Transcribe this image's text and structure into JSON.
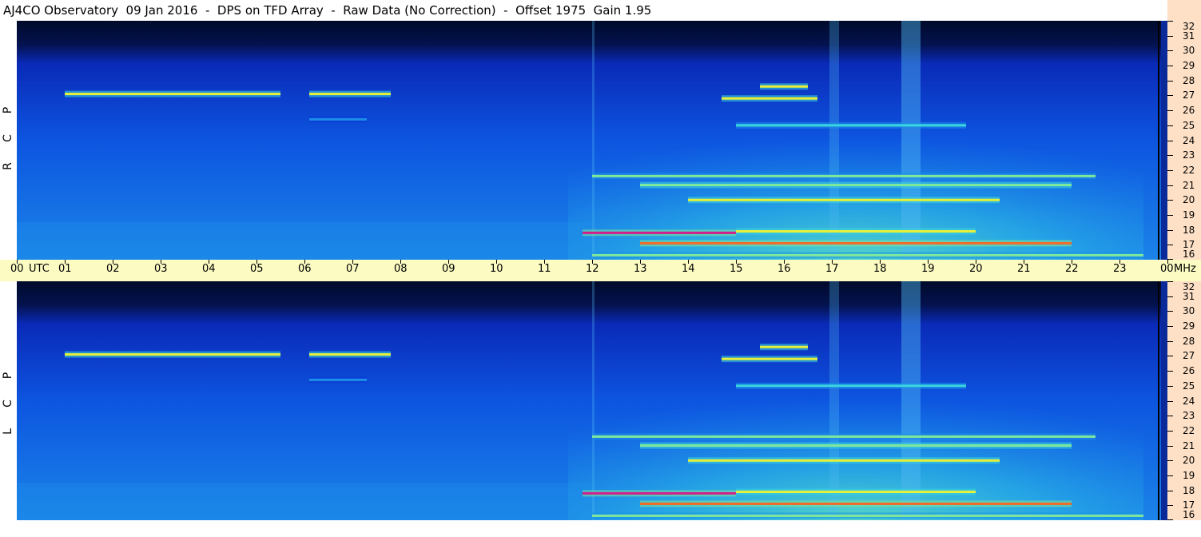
{
  "title": "AJ4CO Observatory  09 Jan 2016  -  DPS on TFD Array  -  Raw Data (No Correction)  -  Offset 1975  Gain 1.95",
  "chart_data": {
    "type": "heatmap",
    "panels": [
      {
        "name": "RCP",
        "side_letters": [
          "R",
          "C",
          "P"
        ]
      },
      {
        "name": "LCP",
        "side_letters": [
          "L",
          "C",
          "P"
        ]
      }
    ],
    "x_axis": {
      "unit_label": "UTC",
      "ticks": [
        "00",
        "01",
        "02",
        "03",
        "04",
        "05",
        "06",
        "07",
        "08",
        "09",
        "10",
        "11",
        "12",
        "13",
        "14",
        "15",
        "16",
        "17",
        "18",
        "19",
        "20",
        "21",
        "22",
        "23",
        "00"
      ],
      "range_hours": [
        0,
        24
      ]
    },
    "y_axis": {
      "unit_label": "MHz",
      "ticks": [
        "16",
        "17",
        "18",
        "19",
        "20",
        "21",
        "22",
        "23",
        "24",
        "25",
        "26",
        "27",
        "28",
        "29",
        "30",
        "31",
        "32"
      ],
      "range_mhz": [
        16,
        32
      ]
    },
    "colormap": [
      "#000a2a",
      "#0a1f8a",
      "#0a3bd6",
      "#1c8fe8",
      "#3ad6e0",
      "#7fe89a",
      "#e6f03a",
      "#f26a2a",
      "#d21e8c"
    ],
    "features": [
      {
        "kind": "band",
        "t_start": 1.0,
        "t_end": 5.5,
        "f_mhz": 27.1,
        "level": 0.75
      },
      {
        "kind": "band",
        "t_start": 6.1,
        "t_end": 7.8,
        "f_mhz": 27.1,
        "level": 0.7
      },
      {
        "kind": "band",
        "t_start": 6.1,
        "t_end": 7.3,
        "f_mhz": 25.4,
        "level": 0.4
      },
      {
        "kind": "band",
        "t_start": 14.7,
        "t_end": 16.7,
        "f_mhz": 26.8,
        "level": 0.8
      },
      {
        "kind": "band",
        "t_start": 15.5,
        "t_end": 16.5,
        "f_mhz": 27.6,
        "level": 0.8
      },
      {
        "kind": "band",
        "t_start": 15.0,
        "t_end": 19.8,
        "f_mhz": 25.0,
        "level": 0.55
      },
      {
        "kind": "band",
        "t_start": 12.0,
        "t_end": 22.5,
        "f_mhz": 21.6,
        "level": 0.6
      },
      {
        "kind": "band",
        "t_start": 13.0,
        "t_end": 22.0,
        "f_mhz": 21.0,
        "level": 0.65
      },
      {
        "kind": "band",
        "t_start": 14.0,
        "t_end": 20.5,
        "f_mhz": 20.0,
        "level": 0.8
      },
      {
        "kind": "band",
        "t_start": 11.8,
        "t_end": 15.0,
        "f_mhz": 17.8,
        "level": 0.95
      },
      {
        "kind": "band",
        "t_start": 15.0,
        "t_end": 20.0,
        "f_mhz": 17.9,
        "level": 0.7
      },
      {
        "kind": "band",
        "t_start": 13.0,
        "t_end": 22.0,
        "f_mhz": 17.1,
        "level": 0.85
      },
      {
        "kind": "band",
        "t_start": 12.0,
        "t_end": 23.5,
        "f_mhz": 16.3,
        "level": 0.6
      }
    ]
  }
}
